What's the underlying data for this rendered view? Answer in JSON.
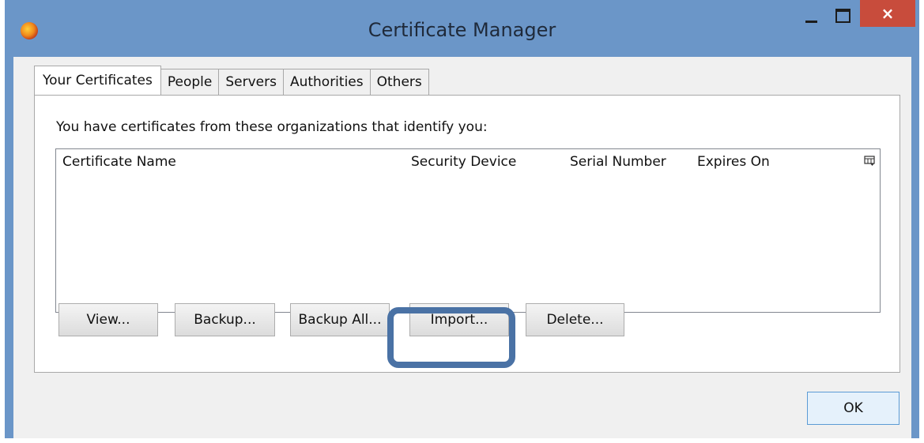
{
  "window": {
    "title": "Certificate Manager",
    "app_icon": "firefox-icon",
    "controls": {
      "minimize": "minimize-icon",
      "maximize": "maximize-icon",
      "close": "×"
    }
  },
  "tabs": [
    {
      "label": "Your Certificates",
      "active": true
    },
    {
      "label": "People",
      "active": false
    },
    {
      "label": "Servers",
      "active": false
    },
    {
      "label": "Authorities",
      "active": false
    },
    {
      "label": "Others",
      "active": false
    }
  ],
  "panel": {
    "intro": "You have certificates from these organizations that identify you:",
    "table": {
      "columns": [
        "Certificate Name",
        "Security Device",
        "Serial Number",
        "Expires On"
      ],
      "rows": [],
      "column_picker_icon": "column-picker-icon"
    },
    "buttons": {
      "view": "View...",
      "backup": "Backup...",
      "backup_all": "Backup All...",
      "import": "Import...",
      "delete": "Delete..."
    }
  },
  "footer": {
    "ok": "OK"
  },
  "colors": {
    "titlebar": "#6b96c8",
    "close_button": "#c84c3c",
    "highlight_border": "#4a72a5",
    "ok_button_border": "#5b9bd5"
  }
}
